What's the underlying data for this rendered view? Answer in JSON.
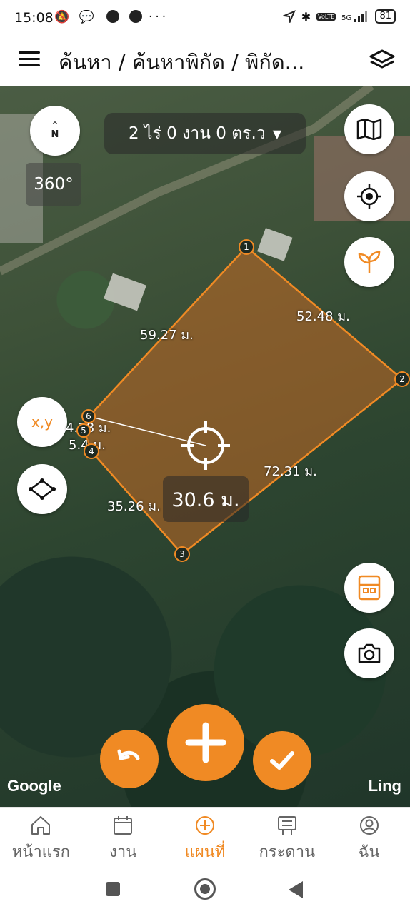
{
  "status_bar": {
    "time": "15:08",
    "left_icons": "🔕 💬",
    "more": "···",
    "network": "5G",
    "volte": "VoLTE",
    "battery": "81"
  },
  "app_bar": {
    "title": "ค้นหา / ค้นหาพิกัด / พิกัด..."
  },
  "map": {
    "area_text": "2 ไร่ 0 งาน 0 ตร.ว",
    "rotation": "360°",
    "compass_letter": "N",
    "xy_label": "x,y",
    "measure_value": "30.6 ม.",
    "side_labels": {
      "s12": "52.48 ม.",
      "s23": "72.31 ม.",
      "s34": "35.26 ม.",
      "s61": "59.27 ม.",
      "s56": "4.28 ม.",
      "s45": "5.4 ม."
    },
    "vertices": [
      "1",
      "2",
      "3",
      "4",
      "5",
      "6"
    ],
    "google": "Google",
    "attribution": "Ling"
  },
  "bottom_nav": {
    "items": [
      {
        "label": "หน้าแรก",
        "icon": "home-icon"
      },
      {
        "label": "งาน",
        "icon": "calendar-icon"
      },
      {
        "label": "แผนที่",
        "icon": "add-circle-icon"
      },
      {
        "label": "กระดาน",
        "icon": "board-icon"
      },
      {
        "label": "ฉัน",
        "icon": "profile-icon"
      }
    ],
    "active_index": 2
  },
  "colors": {
    "accent": "#f08a24",
    "polygon_fill": "#c46a25"
  }
}
